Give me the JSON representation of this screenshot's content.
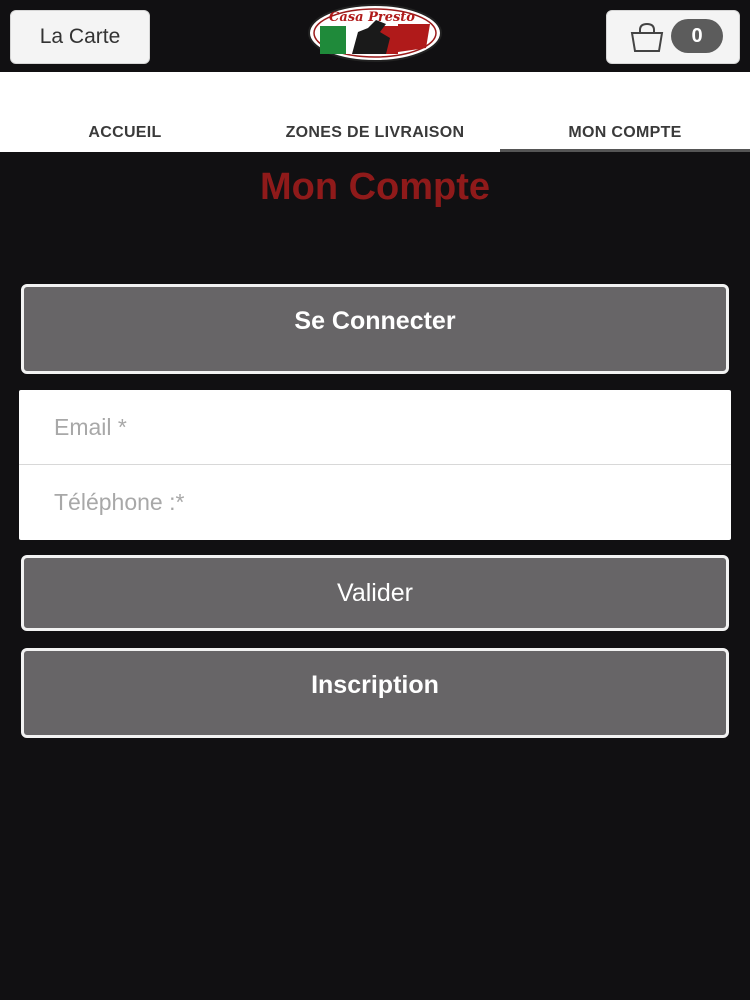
{
  "header": {
    "menu_label": "La Carte",
    "cart_count": "0",
    "logo_text": "Casa Presto"
  },
  "nav": {
    "tabs": [
      {
        "label": "ACCUEIL",
        "active": false
      },
      {
        "label": "ZONES DE LIVRAISON",
        "active": false
      },
      {
        "label": "MON COMPTE",
        "active": true
      }
    ]
  },
  "page": {
    "title": "Mon Compte",
    "connect_label": "Se Connecter",
    "form": {
      "email_placeholder": "Email *",
      "email_value": "",
      "phone_placeholder": "Téléphone :*",
      "phone_value": ""
    },
    "validate_label": "Valider",
    "signup_label": "Inscription"
  },
  "colors": {
    "background": "#111012",
    "title": "#8f1a1a",
    "button": "#676567",
    "flag_green": "#1f8a3a",
    "flag_red": "#b01a1a"
  },
  "icons": {
    "cart": "shopping-bag-icon"
  }
}
